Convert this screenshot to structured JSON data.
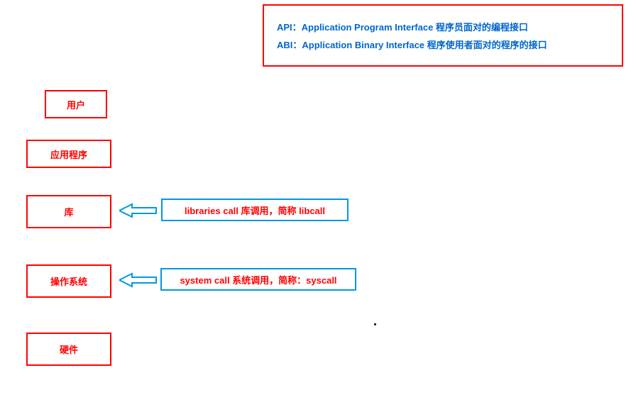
{
  "legend": {
    "line1": "API：Application Program Interface 程序员面对的编程接口",
    "line2": "ABI：Application Binary Interface 程序使用者面对的程序的接口"
  },
  "stack": {
    "user": "用户",
    "app": "应用程序",
    "lib": "库",
    "os": "操作系统",
    "hw": "硬件"
  },
  "annot": {
    "libcall": "libraries call 库调用，简称 libcall",
    "syscall": "system call 系统调用，简称：syscall"
  }
}
